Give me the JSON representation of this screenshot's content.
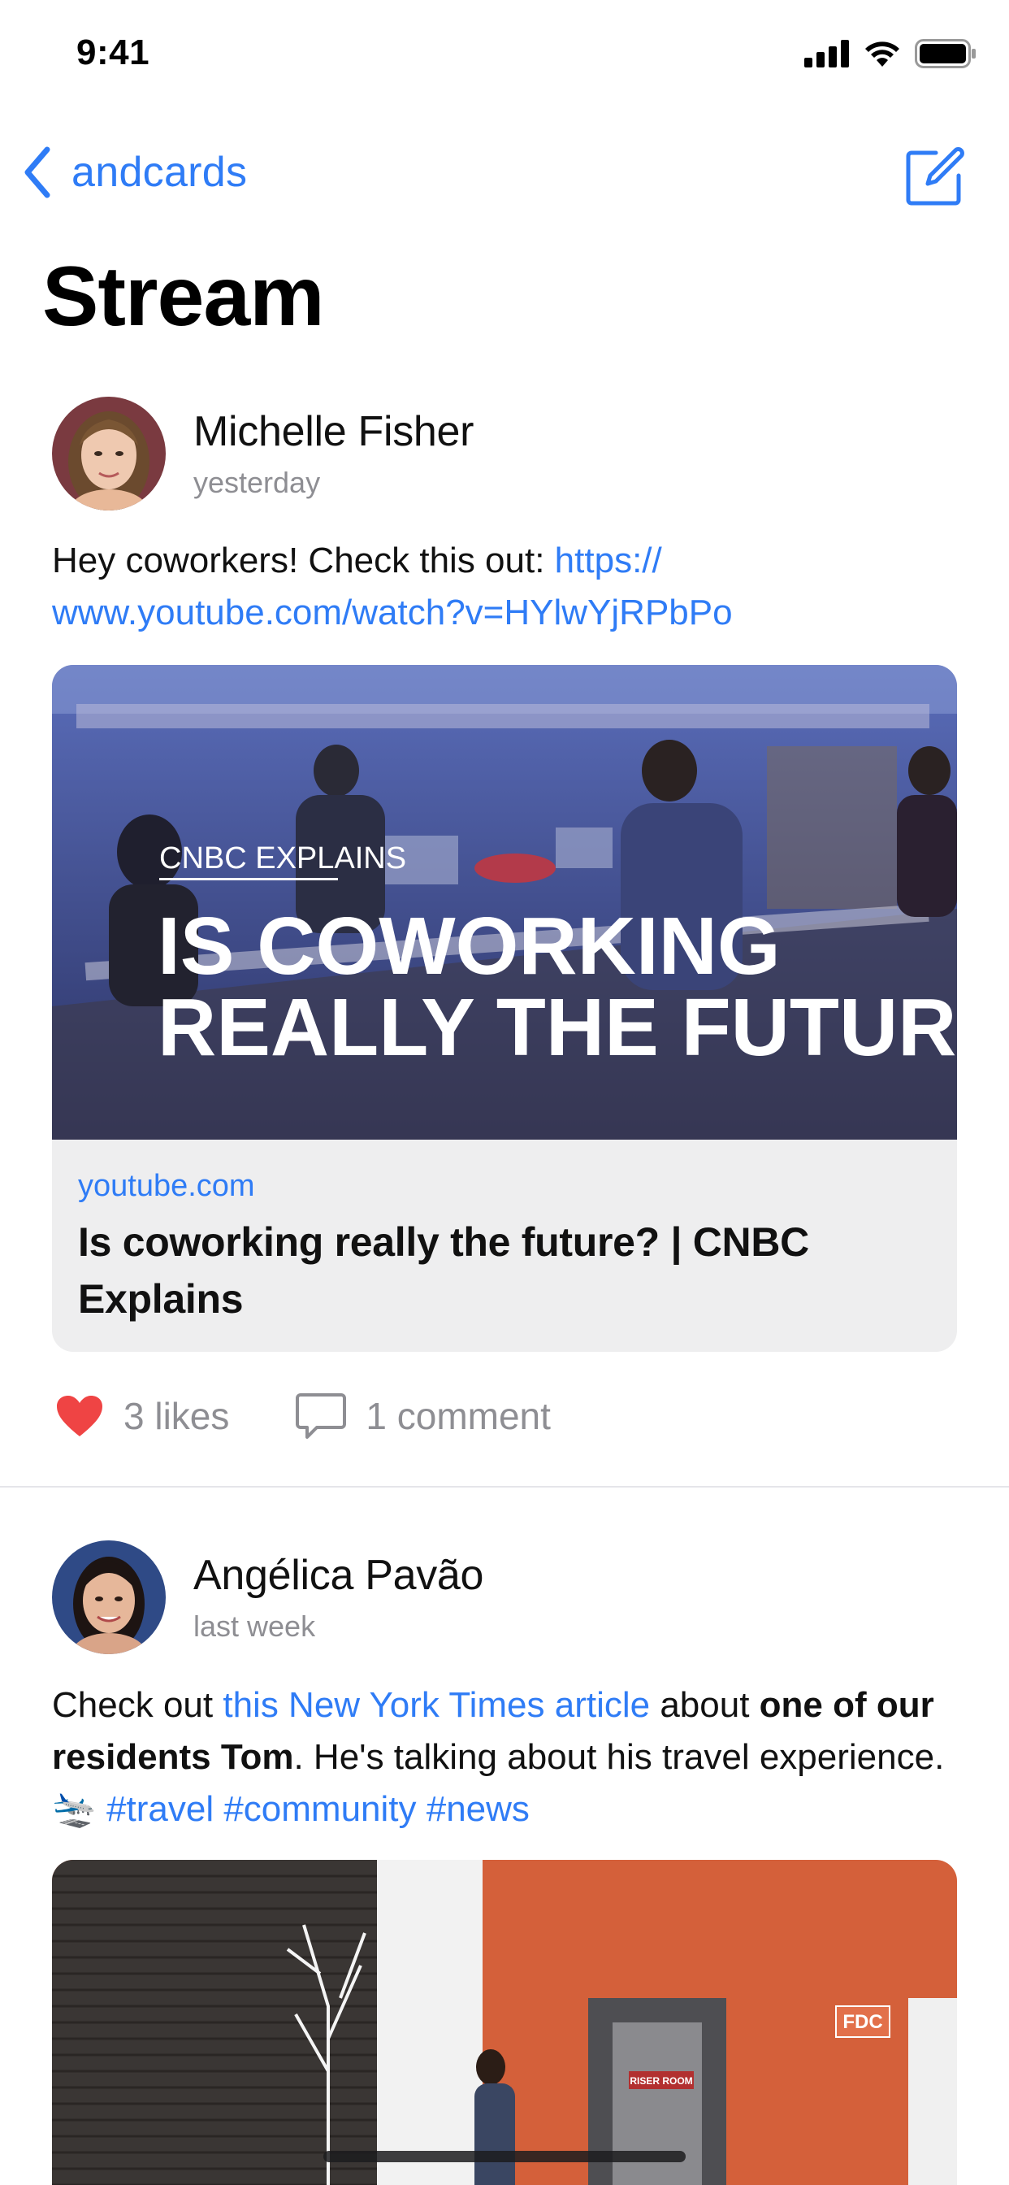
{
  "status": {
    "time": "9:41"
  },
  "nav": {
    "back_label": "andcards"
  },
  "page": {
    "title": "Stream"
  },
  "posts": [
    {
      "author": "Michelle Fisher",
      "time": "yesterday",
      "text_prefix": "Hey coworkers! Check this out: ",
      "link_line1": "https://",
      "link_line2": "www.youtube.com/watch?v=HYlwYjRPbPo",
      "card": {
        "overlay_kicker": "CNBC EXPLAINS",
        "overlay_line1": "IS COWORKING",
        "overlay_line2": "REALLY THE FUTURE?",
        "domain": "youtube.com",
        "title": "Is coworking really the future? | CNBC Explains"
      },
      "likes_label": "3 likes",
      "comments_label": "1 comment"
    },
    {
      "author": "Angélica Pavão",
      "time": "last week",
      "t1": "Check out ",
      "link1": "this New York Times article",
      "t2": " about ",
      "bold1": "one of our residents Tom",
      "t3": ". He's talking about his travel experience. ",
      "emoji": "🛬",
      "hashtags": "#travel #community #news",
      "photo": {
        "sign": "FDC",
        "door_label": "RISER ROOM"
      }
    }
  ],
  "colors": {
    "accent": "#2F7CF6",
    "like": "#EF4444",
    "muted": "#8e8e93"
  }
}
